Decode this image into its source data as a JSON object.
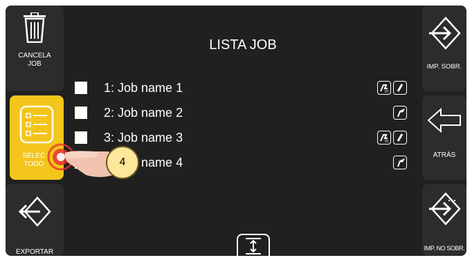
{
  "title": "LISTA JOB",
  "left_buttons": {
    "delete_label_line1": "CANCELA",
    "delete_label_line2": "JOB",
    "select_all_label_line1": "SELEC",
    "select_all_label_line2": "TODO",
    "export_label": "EXPORTAR"
  },
  "right_buttons": {
    "import_overwrite_label": "IMP. SOBR.",
    "back_label": "ATRÁS",
    "import_no_overwrite_label": "IMP. NO SOBR."
  },
  "jobs": [
    {
      "label": "1: Job name 1",
      "processes": [
        "mig-dc-icon",
        "electrode-icon"
      ]
    },
    {
      "label": "2: Job name 2",
      "processes": [
        "tig-icon"
      ]
    },
    {
      "label": "3: Job name 3",
      "processes": [
        "mig-dc-icon",
        "electrode-icon"
      ]
    },
    {
      "label": "4: Job name 4",
      "processes": [
        "tig-icon"
      ]
    }
  ],
  "callout": {
    "number": "4"
  },
  "colors": {
    "screen_bg": "#202020",
    "button_bg": "#2c2c2c",
    "accent_yellow": "#f4c51b",
    "text": "#ffffff"
  }
}
